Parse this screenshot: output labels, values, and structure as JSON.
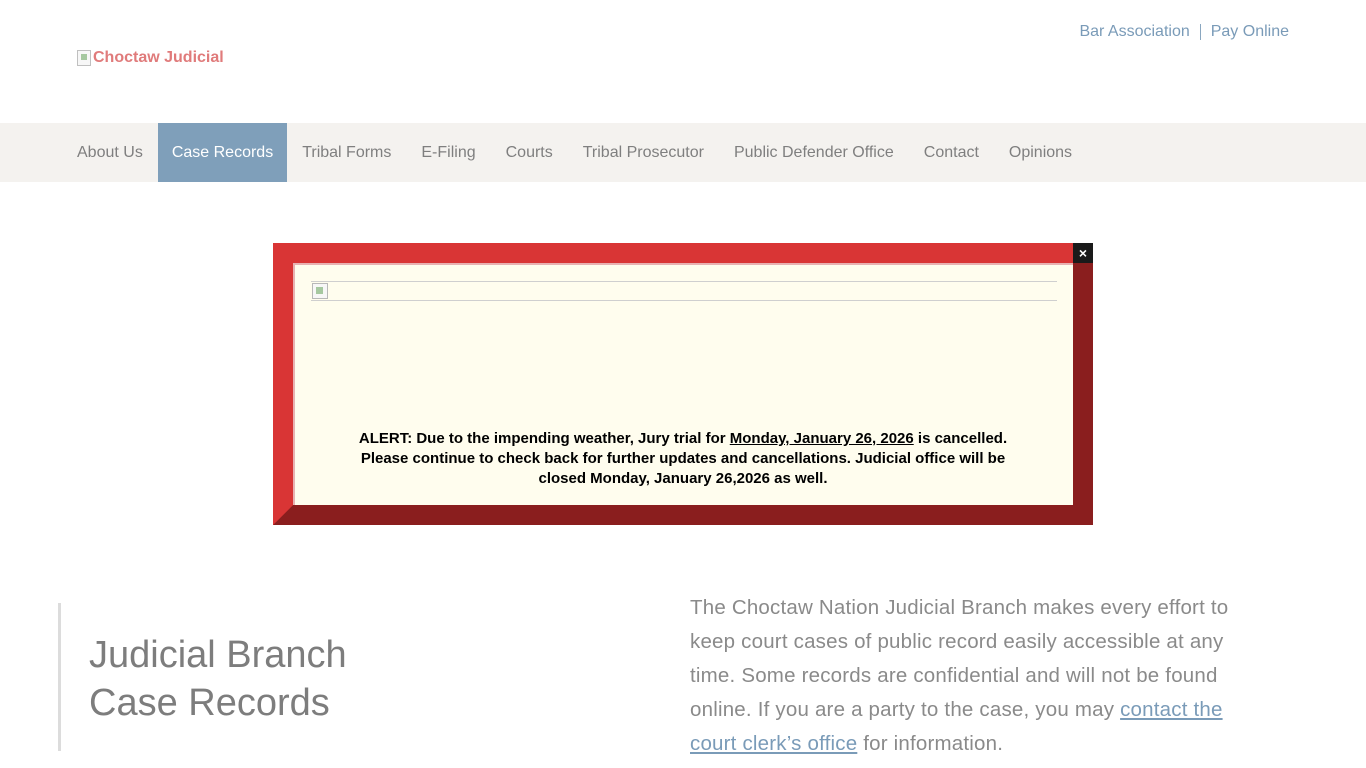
{
  "header": {
    "logo_alt": "Choctaw Judicial",
    "util_links": [
      "Bar Association",
      "Pay Online"
    ]
  },
  "nav": {
    "items": [
      "About Us",
      "Case Records",
      "Tribal Forms",
      "E-Filing",
      "Courts",
      "Tribal Prosecutor",
      "Public Defender Office",
      "Contact",
      "Opinions"
    ],
    "active": "Case Records"
  },
  "alert": {
    "close_label": "×",
    "text_part1": "ALERT: Due to the impending weather, Jury trial for ",
    "text_date": "Monday, January 26, 2026",
    "text_part2": " is cancelled. Please continue to check back for further updates and cancellations. Judicial office will be closed Monday, January 26,2026 as well."
  },
  "content": {
    "heading_line1": "Judicial Branch",
    "heading_line2": "Case Records",
    "intro_before_link": "The Choctaw Nation Judicial Branch makes every effort to keep court cases of public record easily accessible at any time. Some records are confidential and will not be found online. If you are a party to the case, you may ",
    "intro_link": "contact the court clerk’s office",
    "intro_after_link": " for information."
  },
  "colors": {
    "nav_active_bg": "#7f9fba",
    "alert_red": "#d93535",
    "alert_dark_red": "#8a1e1e",
    "alert_bg": "#fffdee",
    "link_blue": "#7a9bb8"
  }
}
